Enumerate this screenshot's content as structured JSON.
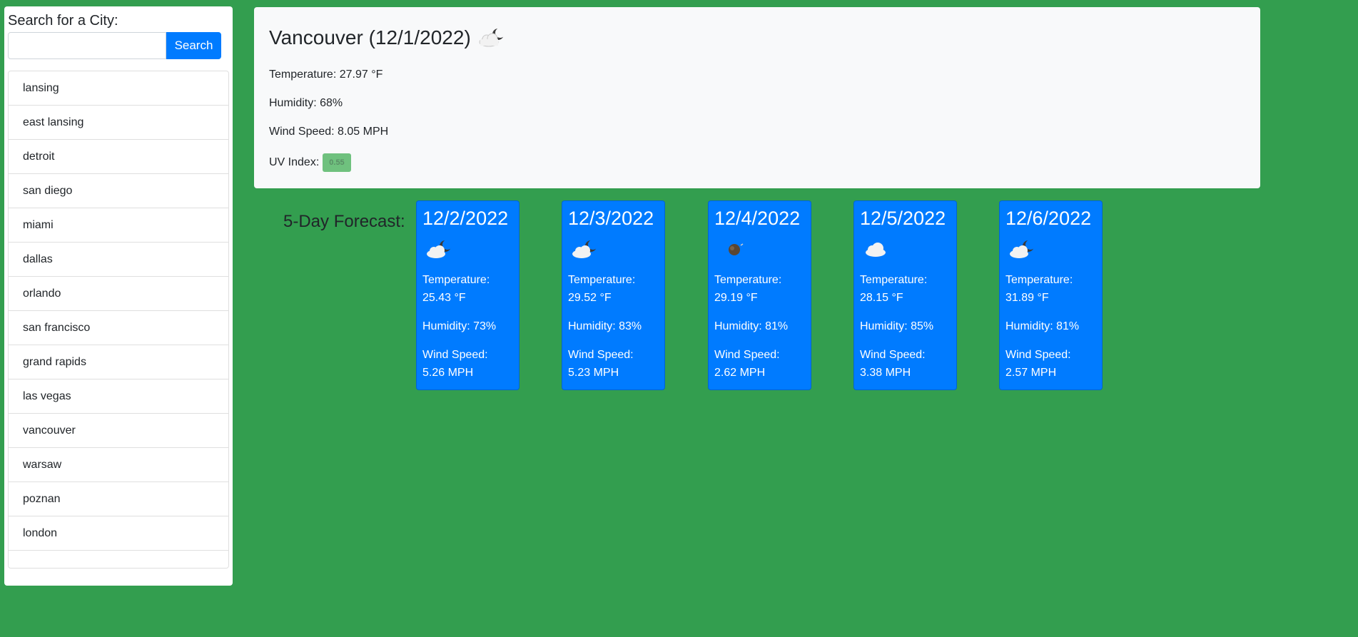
{
  "search": {
    "label": "Search for a City:",
    "input_value": "",
    "button_label": "Search"
  },
  "history": [
    "lansing",
    "east lansing",
    "detroit",
    "san diego",
    "miami",
    "dallas",
    "orlando",
    "san francisco",
    "grand rapids",
    "las vegas",
    "vancouver",
    "warsaw",
    "poznan",
    "london"
  ],
  "current": {
    "title": "Vancouver (12/1/2022)",
    "icon": "cloud-moon-icon",
    "temperature": "Temperature: 27.97 °F",
    "humidity": "Humidity: 68%",
    "wind": "Wind Speed: 8.05 MPH",
    "uv_label": "UV Index:",
    "uv_value": "0.55"
  },
  "forecast": {
    "heading": "5-Day Forecast:",
    "days": [
      {
        "date": "12/2/2022",
        "icon": "cloud-moon-icon",
        "temp_label": "Temperature:",
        "temp_value": "25.43 °F",
        "humidity": "Humidity: 73%",
        "wind_label": "Wind Speed:",
        "wind_value": "5.26 MPH"
      },
      {
        "date": "12/3/2022",
        "icon": "cloud-moon-icon",
        "temp_label": "Temperature:",
        "temp_value": "29.52 °F",
        "humidity": "Humidity: 83%",
        "wind_label": "Wind Speed:",
        "wind_value": "5.23 MPH"
      },
      {
        "date": "12/4/2022",
        "icon": "moon-icon",
        "temp_label": "Temperature:",
        "temp_value": "29.19 °F",
        "humidity": "Humidity: 81%",
        "wind_label": "Wind Speed:",
        "wind_value": "2.62 MPH"
      },
      {
        "date": "12/5/2022",
        "icon": "cloud-icon",
        "temp_label": "Temperature:",
        "temp_value": "28.15 °F",
        "humidity": "Humidity: 85%",
        "wind_label": "Wind Speed:",
        "wind_value": "3.38 MPH"
      },
      {
        "date": "12/6/2022",
        "icon": "cloud-moon-icon",
        "temp_label": "Temperature:",
        "temp_value": "31.89 °F",
        "humidity": "Humidity: 81%",
        "wind_label": "Wind Speed:",
        "wind_value": "2.57 MPH"
      }
    ]
  },
  "colors": {
    "background": "#339e4f",
    "primary": "#007bff",
    "uv_badge": "#6fc17e"
  }
}
